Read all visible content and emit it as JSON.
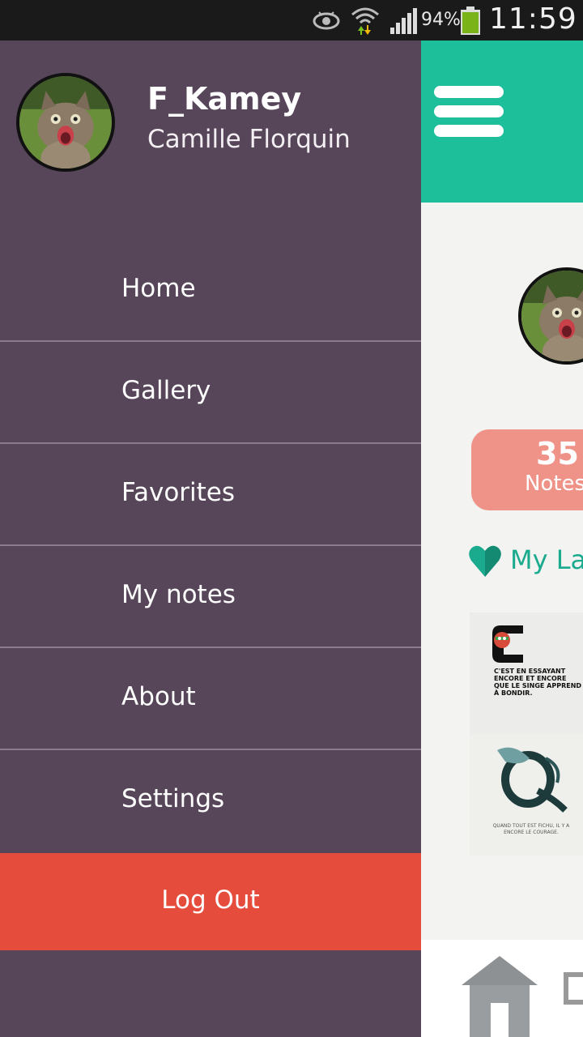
{
  "status_bar": {
    "battery_percent": "94%",
    "time": "11:59",
    "icons": [
      "eye-icon",
      "wifi-icon",
      "signal-icon",
      "battery-icon"
    ]
  },
  "drawer": {
    "username": "F_Kamey",
    "full_name": "Camille Florquin",
    "menu": [
      {
        "label": "Home"
      },
      {
        "label": "Gallery"
      },
      {
        "label": "Favorites"
      },
      {
        "label": "My notes"
      },
      {
        "label": "About"
      },
      {
        "label": "Settings"
      }
    ],
    "logout_label": "Log Out"
  },
  "main": {
    "notes_count": "35",
    "notes_label": "Notes",
    "section_title": "My Lat",
    "poster1_text": "C'EST EN ESSAYANT ENCORE ET ENCORE QUE LE SINGE APPREND À BONDIR.",
    "poster2_caption": "QUAND TOUT EST FICHU, IL Y A ENCORE LE COURAGE."
  },
  "colors": {
    "drawer_bg": "#574659",
    "accent": "#1dbf9b",
    "logout": "#e64c3c",
    "notes_badge": "#ef9288"
  }
}
